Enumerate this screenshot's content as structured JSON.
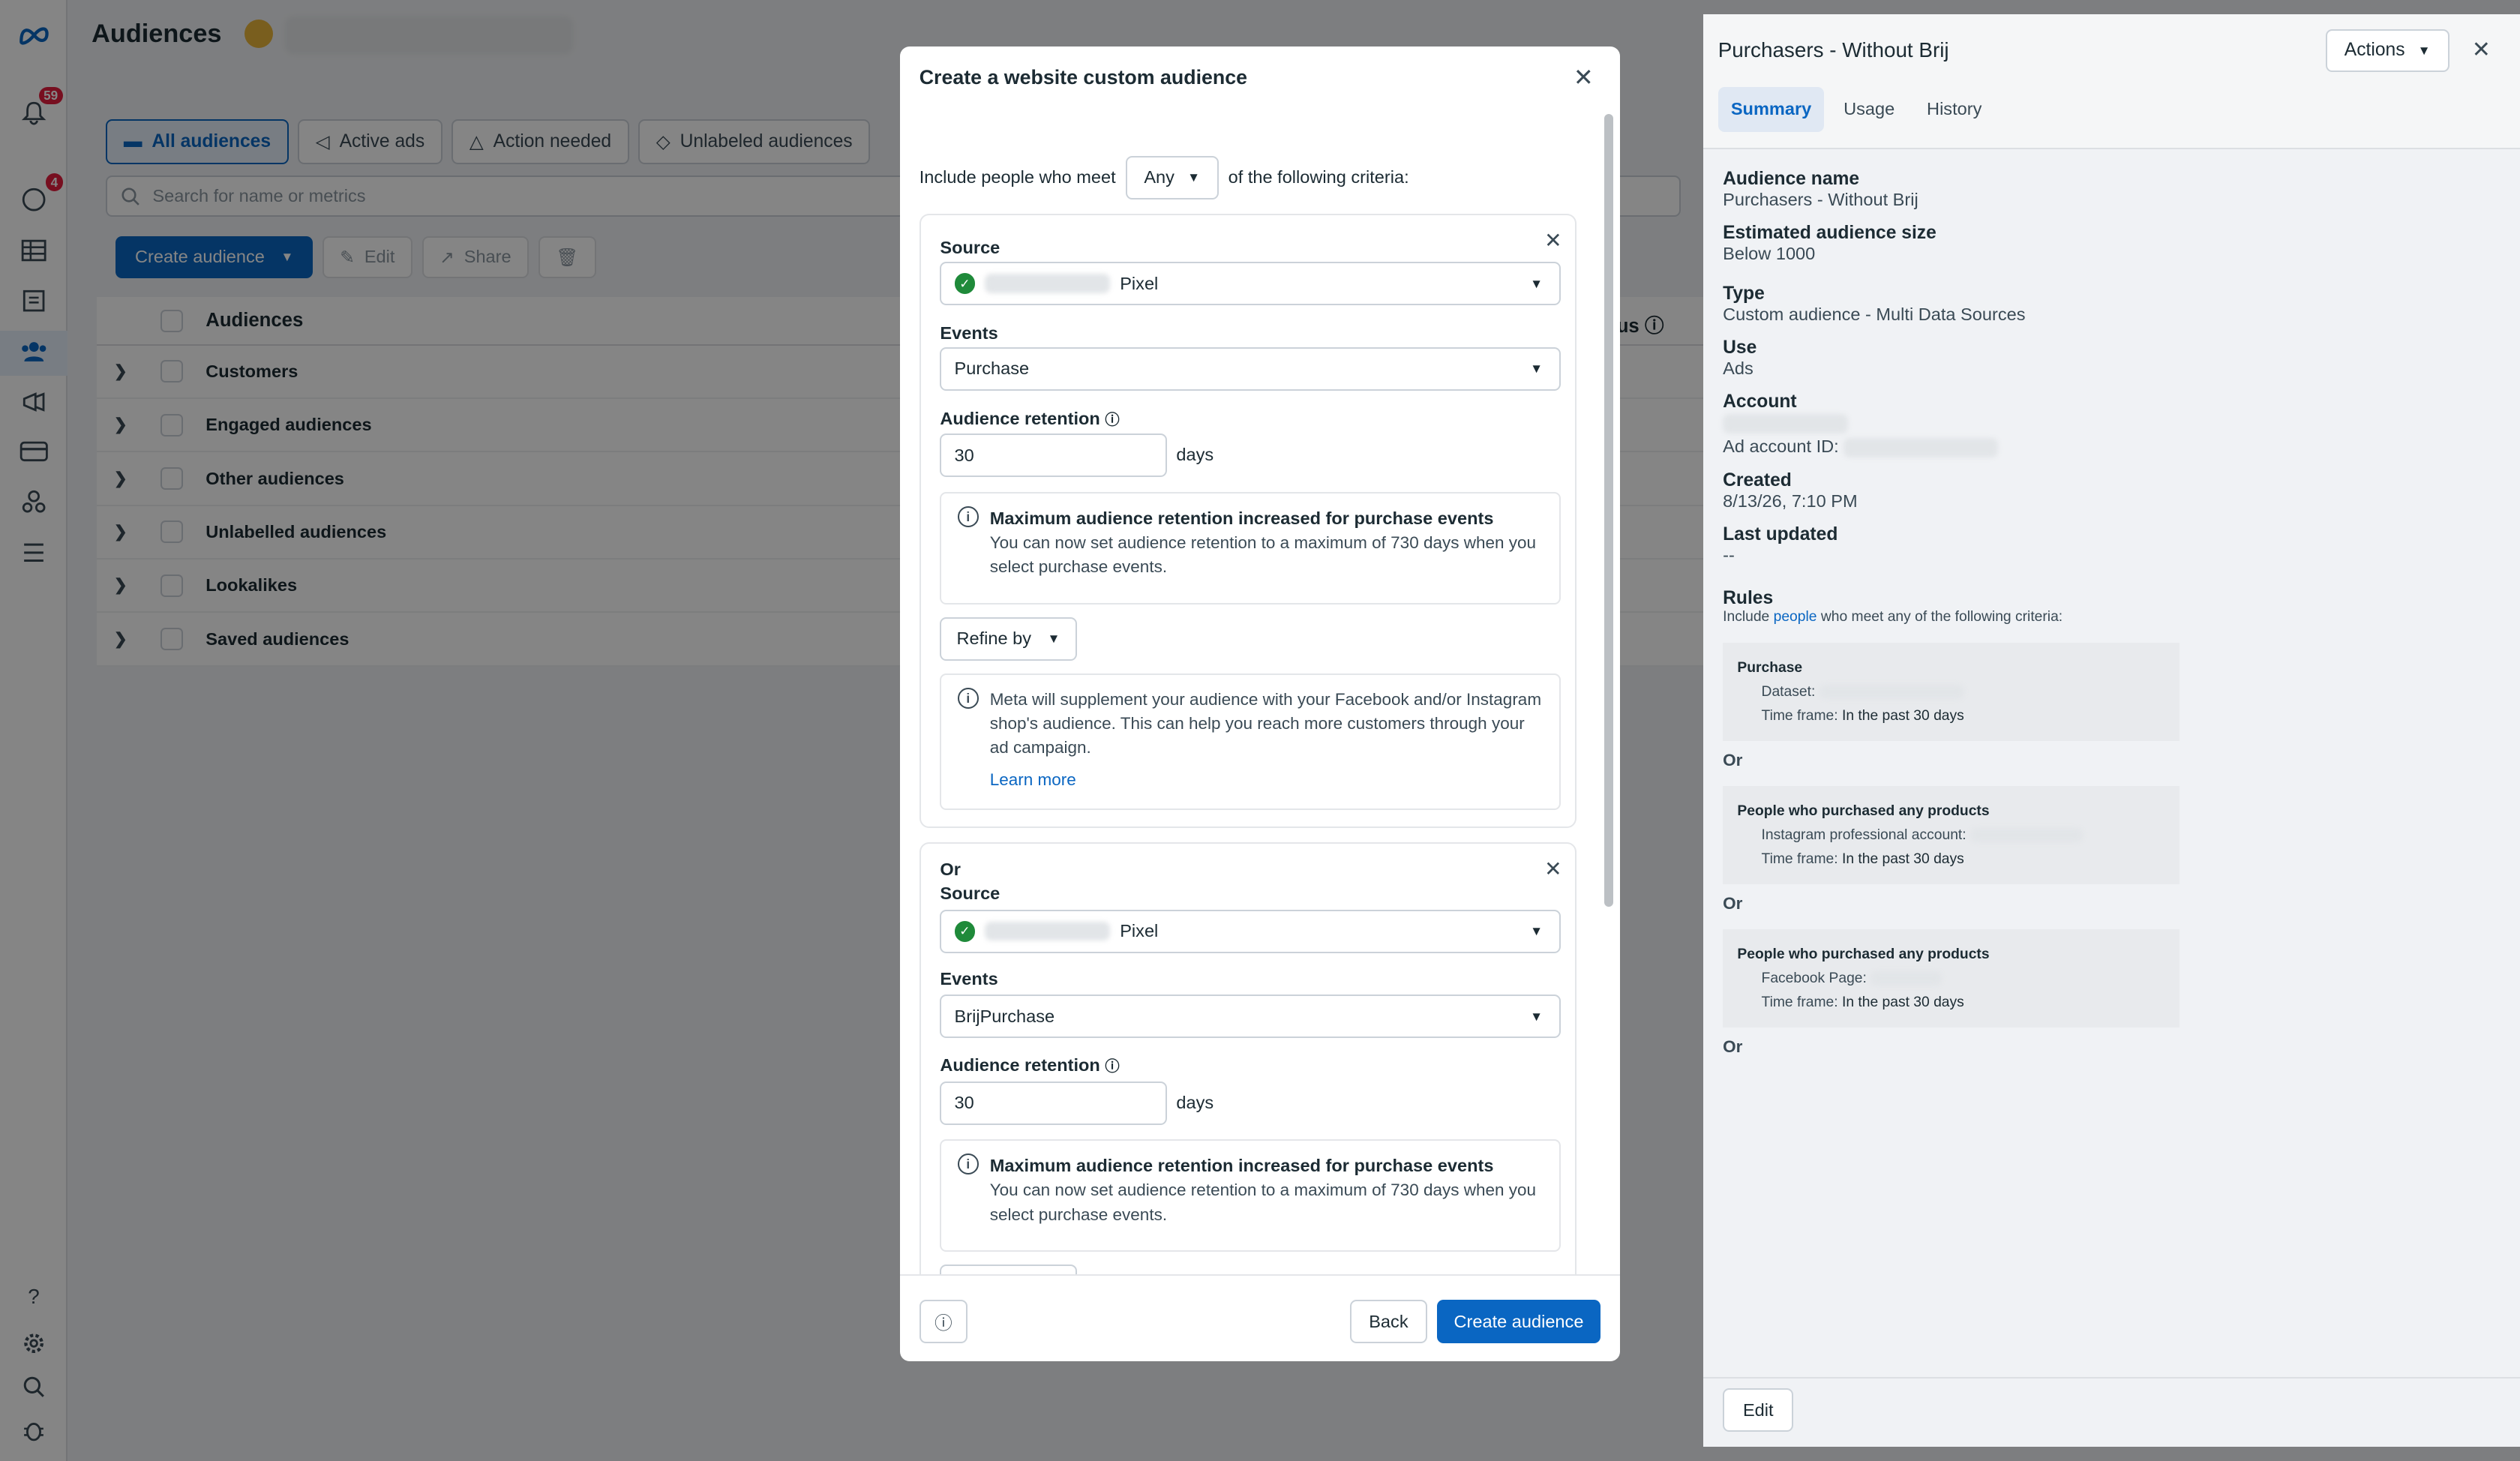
{
  "nav": {
    "badges": {
      "notifications": "59",
      "messages": "4"
    },
    "icons": [
      "meta-logo-icon",
      "bell-icon",
      "chat-icon",
      "table-icon",
      "catalog-icon",
      "audience-icon",
      "megaphone-icon",
      "billing-icon",
      "business-icon",
      "menu-icon",
      "help-icon",
      "settings-icon",
      "search-icon",
      "bug-icon"
    ]
  },
  "page": {
    "title": "Audiences",
    "tabs": [
      "All audiences",
      "Active ads",
      "Action needed",
      "Unlabeled audiences"
    ],
    "search_placeholder": "Search for name or metrics",
    "toolbar": {
      "create": "Create audience",
      "edit": "Edit",
      "share": "Share"
    },
    "table": {
      "header": "Audiences",
      "status_header": "us",
      "rows": [
        "Customers",
        "Engaged audiences",
        "Other audiences",
        "Unlabelled audiences",
        "Lookalikes",
        "Saved audiences"
      ]
    }
  },
  "panel": {
    "title": "Purchasers - Without Brij",
    "actions": "Actions",
    "tabs": [
      "Summary",
      "Usage",
      "History"
    ],
    "fields": {
      "name_label": "Audience name",
      "name": "Purchasers - Without Brij",
      "size_label": "Estimated audience size",
      "size": "Below 1000",
      "type_label": "Type",
      "type": "Custom audience - Multi Data Sources",
      "use_label": "Use",
      "use": "Ads",
      "account_label": "Account",
      "ad_account_prefix": "Ad account ID:",
      "created_label": "Created",
      "created": "8/13/26, 7:10 PM",
      "updated_label": "Last updated",
      "updated": "--",
      "rules_label": "Rules",
      "rules_prefix": "Include",
      "rules_link": "people",
      "rules_suffix": "who meet any of the following criteria:"
    },
    "rules": [
      {
        "title": "Purchase",
        "line1": "Dataset:",
        "line2_label": "Time frame:",
        "line2": "In the past 30 days"
      },
      {
        "title": "People who purchased any products",
        "line1": "Instagram professional account:",
        "line2_label": "Time frame:",
        "line2": "In the past 30 days"
      },
      {
        "title": "People who purchased any products",
        "line1": "Facebook Page:",
        "line2_label": "Time frame:",
        "line2": "In the past 30 days"
      }
    ],
    "or": "Or",
    "edit": "Edit"
  },
  "modal": {
    "title": "Create a website custom audience",
    "include_prefix": "Include people who meet",
    "include_value": "Any",
    "include_suffix": "of the following criteria:",
    "source_label": "Source",
    "events_label": "Events",
    "retention_label": "Audience retention",
    "days": "days",
    "or": "Or",
    "criteria": [
      {
        "source": "Pixel",
        "event": "Purchase",
        "retention": "30"
      },
      {
        "source": "Pixel",
        "event": "BrijPurchase",
        "retention": "30"
      }
    ],
    "notice_title": "Maximum audience retention increased for purchase events",
    "notice_body": "You can now set audience retention to a maximum of 730 days when you select purchase events.",
    "refine": "Refine by",
    "supplement": "Meta will supplement your audience with your Facebook and/or Instagram shop's audience. This can help you reach more customers through your ad campaign.",
    "learn_more": "Learn more",
    "back": "Back",
    "create": "Create audience"
  },
  "colors": {
    "primary": "#0a66c2",
    "success": "#1f8a3a",
    "badge": "#e41e3f"
  }
}
